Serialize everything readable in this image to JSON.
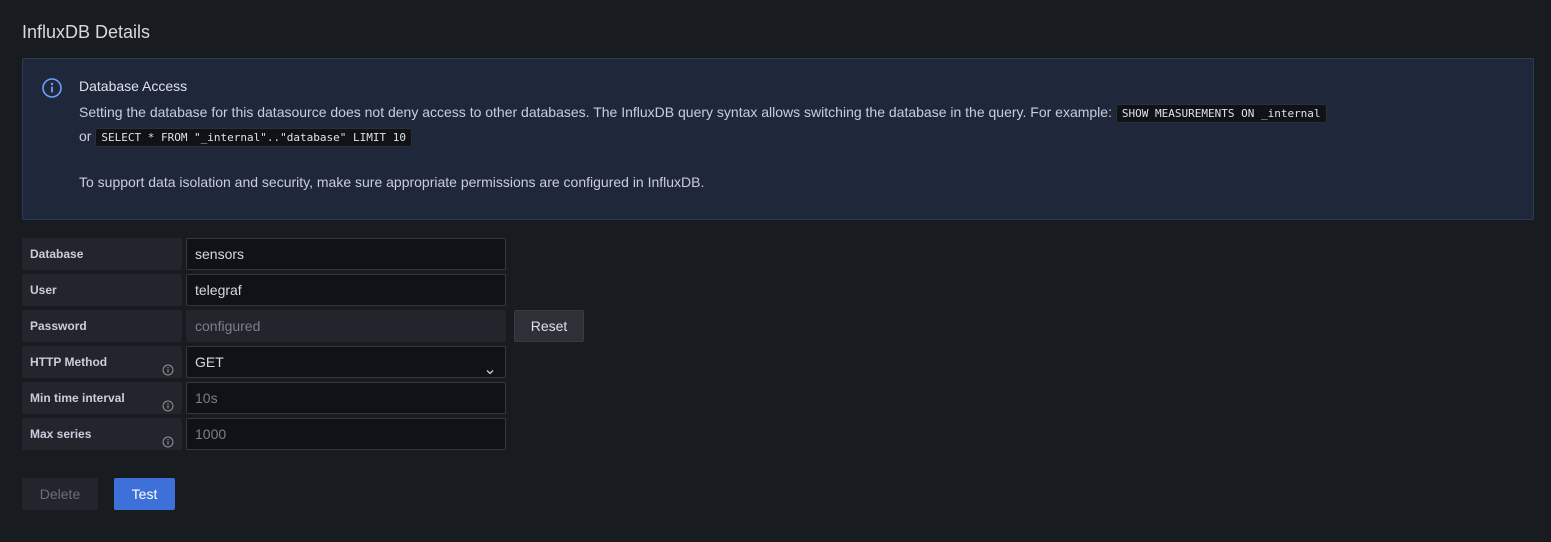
{
  "section": {
    "title": "InfluxDB Details"
  },
  "alert": {
    "icon": "info-circle-icon",
    "title": "Database Access",
    "text_before": "Setting the database for this datasource does not deny access to other databases. The InfluxDB query syntax allows switching the database in the query. For example: ",
    "code1": "SHOW MEASUREMENTS ON _internal",
    "text_or": "or ",
    "code2": "SELECT * FROM \"_internal\"..\"database\" LIMIT 10",
    "note": "To support data isolation and security, make sure appropriate permissions are configured in InfluxDB."
  },
  "form": {
    "database": {
      "label": "Database",
      "value": "sensors"
    },
    "user": {
      "label": "User",
      "value": "telegraf"
    },
    "password": {
      "label": "Password",
      "value": "configured",
      "reset_label": "Reset"
    },
    "http_method": {
      "label": "HTTP Method",
      "value": "GET"
    },
    "min_time_interval": {
      "label": "Min time interval",
      "placeholder": "10s"
    },
    "max_series": {
      "label": "Max series",
      "placeholder": "1000"
    }
  },
  "actions": {
    "delete_label": "Delete",
    "test_label": "Test"
  },
  "colors": {
    "background": "#181b1f",
    "alert_bg": "#1e283a",
    "info_icon": "#6e9fff",
    "primary": "#3d71d9"
  }
}
